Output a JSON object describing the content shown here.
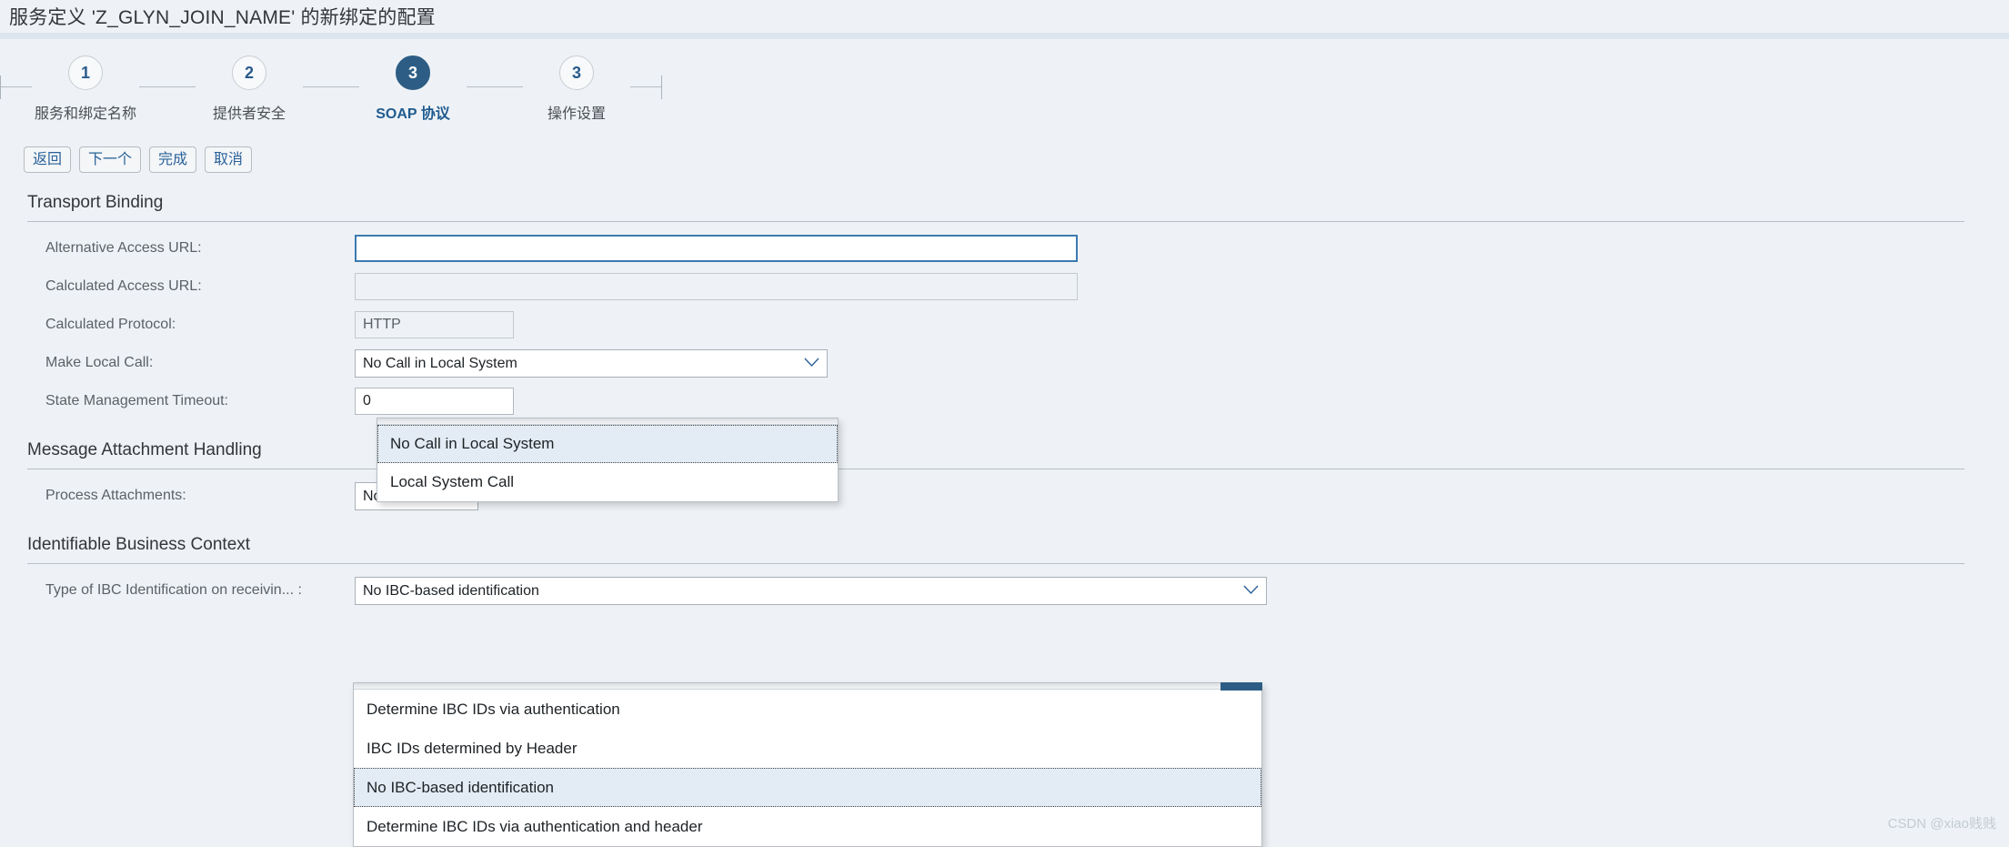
{
  "header": {
    "title": "服务定义 'Z_GLYN_JOIN_NAME' 的新绑定的配置"
  },
  "wizard": {
    "steps": [
      {
        "number": "1",
        "label": "服务和绑定名称",
        "active": false
      },
      {
        "number": "2",
        "label": "提供者安全",
        "active": false
      },
      {
        "number": "3",
        "label": "SOAP 协议",
        "active": true
      },
      {
        "number": "3",
        "label": "操作设置",
        "active": false
      }
    ]
  },
  "toolbar": {
    "back_label": "返回",
    "next_label": "下一个",
    "finish_label": "完成",
    "cancel_label": "取消"
  },
  "sections": {
    "transport": {
      "title": "Transport Binding",
      "alt_access_url_label": "Alternative Access URL:",
      "alt_access_url_value": "",
      "calc_access_url_label": "Calculated Access URL:",
      "calc_access_url_value": "",
      "calc_protocol_label": "Calculated Protocol:",
      "calc_protocol_value": "HTTP",
      "make_local_call_label": "Make Local Call:",
      "make_local_call_value": "No Call in Local System",
      "state_timeout_label": "State Management Timeout:",
      "state_timeout_value": "0"
    },
    "attachment": {
      "title": "Message Attachment Handling",
      "process_attachments_label": "Process Attachments:",
      "process_attachments_value": "No"
    },
    "ibc": {
      "title": "Identifiable Business Context",
      "ibc_type_label": "Type of IBC Identification on receivin... :",
      "ibc_type_value": "No IBC-based identification"
    }
  },
  "dropdowns": {
    "make_local_call": {
      "options": [
        {
          "label": "No Call in Local System",
          "selected": true
        },
        {
          "label": "Local System Call",
          "selected": false
        }
      ]
    },
    "ibc_type": {
      "options": [
        {
          "label": "Determine IBC IDs via authentication",
          "selected": false
        },
        {
          "label": "IBC IDs determined by Header",
          "selected": false
        },
        {
          "label": "No IBC-based identification",
          "selected": true
        },
        {
          "label": "Determine IBC IDs via authentication and header",
          "selected": false
        }
      ]
    }
  },
  "icons": {
    "chevron_down": "⌄"
  },
  "watermark": "CSDN @xiao贱贱",
  "colors": {
    "background": "#eef2f6",
    "accent": "#2d5d84",
    "link": "#2a6199",
    "selected_row": "#e3ecf5"
  }
}
